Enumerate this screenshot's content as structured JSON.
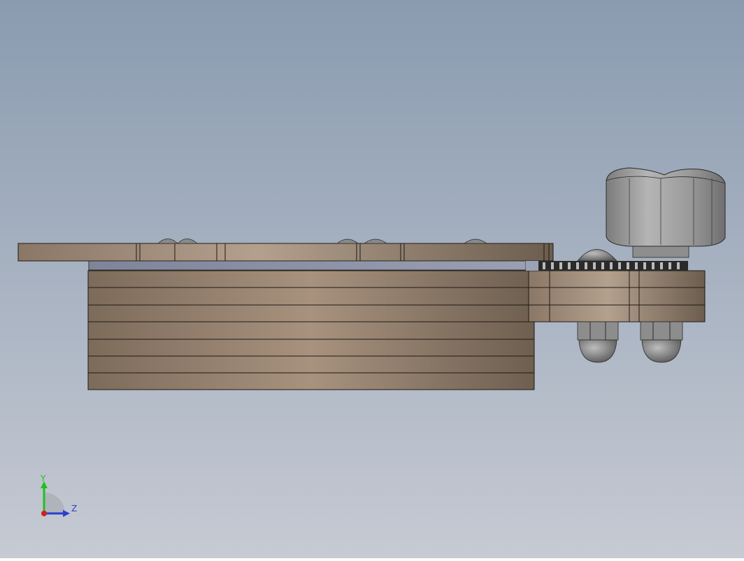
{
  "viewport": {
    "background_top": "#8a9bb0",
    "background_bottom": "#c6cad3"
  },
  "model": {
    "material_color": "#9c8875",
    "highlight_color": "#b3a08d",
    "shadow_color": "#6c5d4e",
    "knob_color": "#9a9a9a",
    "acorn_nut_color": "#8d8d8d",
    "edge_color": "#1e1a16"
  },
  "axes": {
    "y_label": "Y",
    "z_label": "Z",
    "y_color": "#1ec21e",
    "z_color": "#2a3fcf",
    "x_color": "#d02020"
  }
}
